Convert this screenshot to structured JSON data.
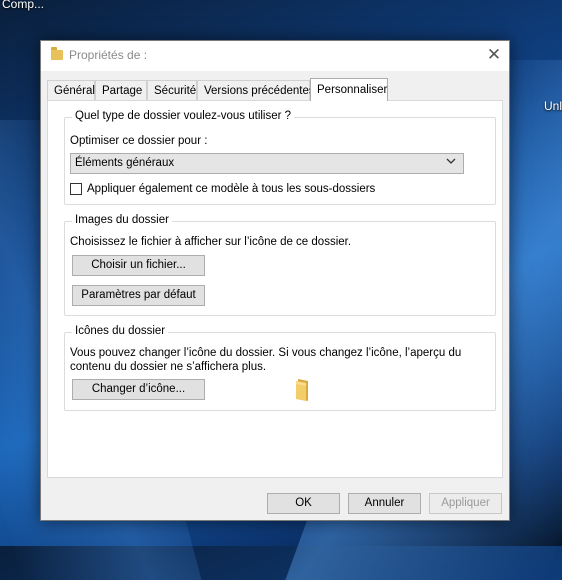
{
  "desktop": {
    "top_label": "Comp...",
    "right_label": "Unl"
  },
  "window": {
    "title": "Propriétés de :",
    "close_glyph": "✕"
  },
  "tabs": [
    {
      "label": "Général"
    },
    {
      "label": "Partage"
    },
    {
      "label": "Sécurité"
    },
    {
      "label": "Versions précédentes"
    },
    {
      "label": "Personnaliser",
      "active": true
    }
  ],
  "folder_type": {
    "title": "Quel type de dossier voulez-vous utiliser ?",
    "optimize_label": "Optimiser ce dossier pour :",
    "selected": "Éléments généraux",
    "apply_sub_label": "Appliquer également ce modèle à tous les sous-dossiers",
    "apply_sub_checked": false
  },
  "folder_images": {
    "title": "Images du dossier",
    "description": "Choisissez le fichier à afficher sur l’icône de ce dossier.",
    "choose_button": "Choisir un fichier...",
    "default_button": "Paramètres par défaut"
  },
  "folder_icons": {
    "title": "Icônes du dossier",
    "description_line1": "Vous pouvez changer l’icône du dossier. Si vous changez l’icône, l’aperçu du",
    "description_line2": "contenu du dossier ne s’affichera plus.",
    "change_button": "Changer d’icône..."
  },
  "footer": {
    "ok": "OK",
    "cancel": "Annuler",
    "apply": "Appliquer"
  },
  "colors": {
    "folder_yellow": "#e8c15a",
    "window_bg": "#f0f0f0",
    "button_bg": "#e1e1e1"
  }
}
